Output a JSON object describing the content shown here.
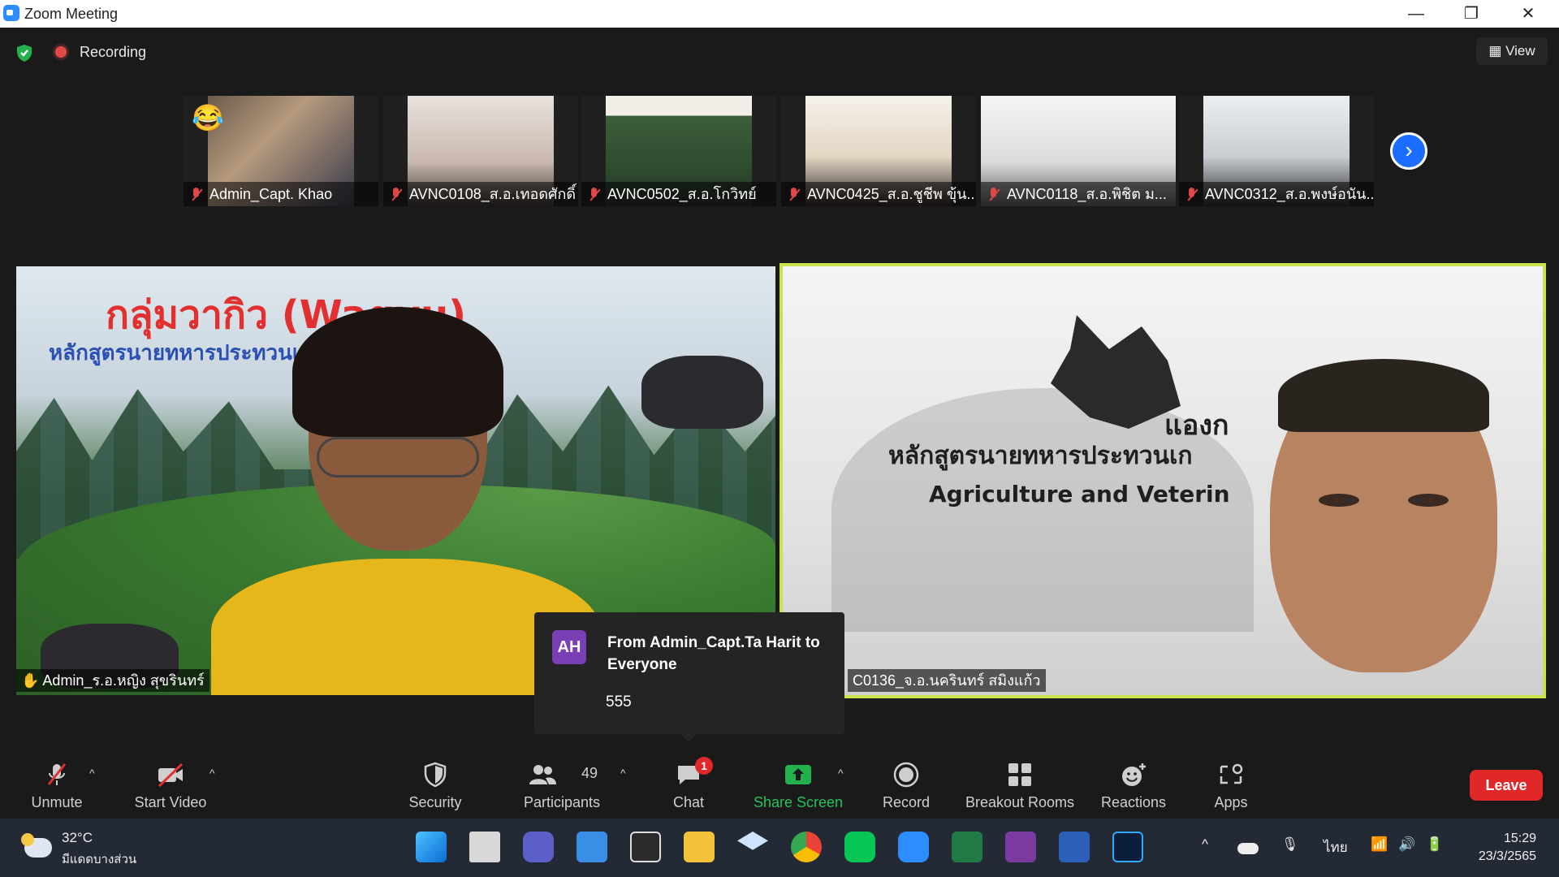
{
  "window": {
    "title": "Zoom Meeting",
    "minimize": "—",
    "restore": "❐",
    "close": "✕"
  },
  "top": {
    "recording_label": "Recording",
    "view_label": "View"
  },
  "thumbnails": [
    {
      "name": "Admin_Capt. Khao"
    },
    {
      "name": "AVNC0108_ส.อ.เทอดศักดิ์"
    },
    {
      "name": "AVNC0502_ส.อ.โกวิทย์"
    },
    {
      "name": "AVNC0425_ส.อ.ชูชีพ ขุ้น..."
    },
    {
      "name": "AVNC0118_ส.อ.พิชิต ม..."
    },
    {
      "name": "AVNC0312_ส.อ.พงษ์อนัน..."
    }
  ],
  "emoji_reaction": "😂",
  "main_videos": {
    "left": {
      "title_text": "กลุ่มวากิว (Wagyu)",
      "subtitle_text": "หลักสูตรนายทหารประทวนเกษ                                    รสัตว์",
      "name": "Admin_ร.อ.หญิง สุขรินทร์"
    },
    "right": {
      "thai_heading": "หลักสูตรนายทหารประทวนเก",
      "english_heading": "Agriculture and Veterin",
      "brand_text": "แองก",
      "name": "C0136_จ.อ.นครินทร์ สมิงแก้ว"
    }
  },
  "chat_popup": {
    "avatar_initials": "AH",
    "from_text": "From Admin_Capt.Ta Harit to Everyone",
    "message": "555"
  },
  "toolbar": {
    "unmute": "Unmute",
    "start_video": "Start Video",
    "security": "Security",
    "participants": "Participants",
    "participants_count": "49",
    "chat": "Chat",
    "chat_badge": "1",
    "share_screen": "Share Screen",
    "record": "Record",
    "breakout_rooms": "Breakout Rooms",
    "reactions": "Reactions",
    "apps": "Apps",
    "leave": "Leave"
  },
  "taskbar": {
    "temperature": "32°C",
    "weather_desc": "มีแดดบางส่วน",
    "language": "ไทย",
    "time": "15:29",
    "date": "23/3/2565"
  },
  "colors": {
    "accent_green": "#22b14c",
    "leave_red": "#e02828",
    "active_border": "#c7e34d"
  }
}
